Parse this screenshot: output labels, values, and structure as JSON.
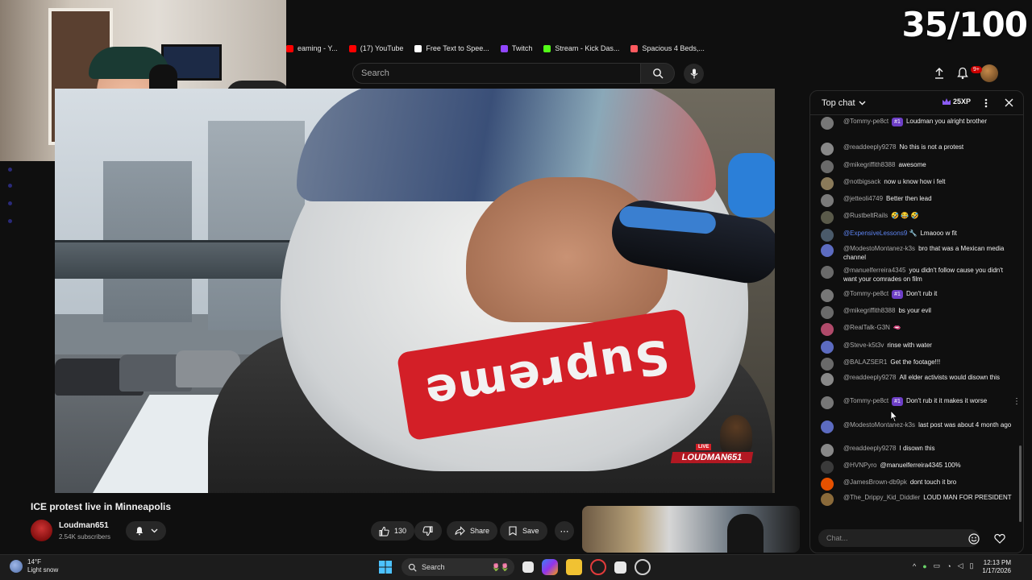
{
  "overlay": {
    "score": "35/100"
  },
  "bookmarks": [
    {
      "label": "eaming - Y...",
      "color": "#ff0000"
    },
    {
      "label": "(17) YouTube",
      "color": "#ff0000"
    },
    {
      "label": "Free Text to Spee...",
      "color": "#ffffff"
    },
    {
      "label": "Twitch",
      "color": "#9146ff"
    },
    {
      "label": "Stream - Kick Das...",
      "color": "#53fc18"
    },
    {
      "label": "Spacious 4 Beds,...",
      "color": "#ff5a5f"
    }
  ],
  "topbar": {
    "search_placeholder": "Search",
    "notif_count": "9+"
  },
  "video": {
    "title": "ICE protest live in Minneapolis",
    "overlay_live": "LIVE",
    "overlay_name": "LOUDMAN651",
    "mask_text": "Supreme"
  },
  "channel": {
    "name": "Loudman651",
    "subs": "2.54K subscribers"
  },
  "actions": {
    "likes": "130",
    "share": "Share",
    "save": "Save"
  },
  "chat": {
    "header": "Top chat",
    "xp": "25XP",
    "input_placeholder": "Chat...",
    "messages": [
      {
        "user": "@Tommy-pe8ct",
        "badge": "#1",
        "text": "Loudman you alright brother",
        "member": false,
        "avatar": "#777"
      },
      {
        "user": "@readdeeply9278",
        "badge": "",
        "text": "No this is not a protest",
        "member": false,
        "avatar": "#888"
      },
      {
        "user": "@mikegriffith8388",
        "badge": "",
        "text": "awesome",
        "member": false,
        "avatar": "#6a6a6a"
      },
      {
        "user": "@notbigsack",
        "badge": "",
        "text": "now u know how i felt",
        "member": false,
        "avatar": "#8a7a5a"
      },
      {
        "user": "@jetteoli4749",
        "badge": "",
        "text": "Better then lead",
        "member": false,
        "avatar": "#7a7a7a"
      },
      {
        "user": "@RustbeltRails",
        "badge": "",
        "text": "🤣 😂 🤣",
        "member": false,
        "avatar": "#5a5a4a"
      },
      {
        "user": "@ExpensiveLessons9 🔧",
        "badge": "",
        "text": "Lmaooo w fit",
        "member": true,
        "avatar": "#4a5a6a"
      },
      {
        "user": "@ModestoMontanez-k3s",
        "badge": "",
        "text": "bro that was a Mexican media channel",
        "member": false,
        "avatar": "#5c6bc0"
      },
      {
        "user": "@manuelferreira4345",
        "badge": "",
        "text": "you didn't follow cause you didn't want your comrades on film",
        "member": false,
        "avatar": "#6a6a6a"
      },
      {
        "user": "@Tommy-pe8ct",
        "badge": "#1",
        "text": "Don't rub it",
        "member": false,
        "avatar": "#777"
      },
      {
        "user": "@mikegriffith8388",
        "badge": "",
        "text": "bs your evil",
        "member": false,
        "avatar": "#6a6a6a"
      },
      {
        "user": "@RealTalk-G3N",
        "badge": "",
        "text": "🫦",
        "member": false,
        "avatar": "#b04a6a"
      },
      {
        "user": "@Steve-k5t3v",
        "badge": "",
        "text": "rinse with water",
        "member": false,
        "avatar": "#5c6bc0"
      },
      {
        "user": "@BALAZSER1",
        "badge": "",
        "text": "Get the footage!!!",
        "member": false,
        "avatar": "#6a6a6a"
      },
      {
        "user": "@readdeeply9278",
        "badge": "",
        "text": "All elder activists would disown this",
        "member": false,
        "avatar": "#888"
      },
      {
        "user": "@Tommy-pe8ct",
        "badge": "#1",
        "text": "Don't rub it it makes it worse",
        "member": false,
        "avatar": "#777"
      },
      {
        "user": "@ModestoMontanez-k3s",
        "badge": "",
        "text": "last post was about 4 month ago",
        "member": false,
        "avatar": "#5c6bc0"
      },
      {
        "user": "@readdeeply9278",
        "badge": "",
        "text": "I disown this",
        "member": false,
        "avatar": "#888"
      },
      {
        "user": "@HVNPyro",
        "badge": "",
        "text": "@manuelferreira4345 100%",
        "member": false,
        "avatar": "#3a3a3a"
      },
      {
        "user": "@JamesBrown-db9pk",
        "badge": "",
        "text": "dont touch it bro",
        "member": false,
        "avatar": "#e65100"
      },
      {
        "user": "@The_Drippy_Kid_Diddler",
        "badge": "",
        "text": "LOUD MAN FOR PRESIDENT",
        "member": false,
        "avatar": "#8a6a3a"
      }
    ]
  },
  "taskbar": {
    "weather_temp": "14°F",
    "weather_desc": "Light snow",
    "search_label": "Search",
    "time": "12:13 PM",
    "date": "1/17/2026"
  }
}
